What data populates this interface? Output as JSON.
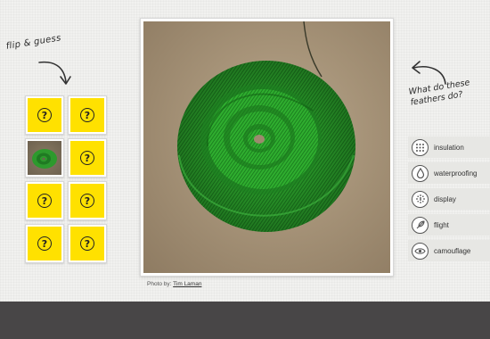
{
  "game": {
    "flip_title": "flip & guess",
    "question": "What do these feathers do?",
    "card_symbol": "?"
  },
  "photo": {
    "credit_prefix": "Photo by:",
    "credit_name": "Tim Laman"
  },
  "options": [
    {
      "label": "insulation",
      "icon": "grid-icon"
    },
    {
      "label": "waterproofing",
      "icon": "water-drop-icon"
    },
    {
      "label": "display",
      "icon": "display-icon"
    },
    {
      "label": "flight",
      "icon": "feather-icon"
    },
    {
      "label": "camouflage",
      "icon": "eye-icon"
    }
  ],
  "colors": {
    "card_yellow": "#ffe100",
    "footer": "#484647",
    "feather_green": "#2aa12a"
  }
}
